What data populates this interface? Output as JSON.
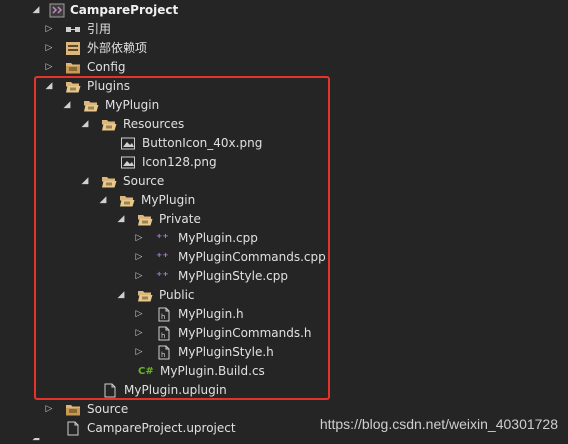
{
  "tree": {
    "solution": "CampareProject",
    "refs": "引用",
    "external_deps": "外部依赖项",
    "config": "Config",
    "plugins": "Plugins",
    "plugin_folder": "MyPlugin",
    "resources": "Resources",
    "res_button_icon": "ButtonIcon_40x.png",
    "res_icon128": "Icon128.png",
    "source_inner": "Source",
    "module_folder": "MyPlugin",
    "private": "Private",
    "cpp_plugin": "MyPlugin.cpp",
    "cpp_commands": "MyPluginCommands.cpp",
    "cpp_style": "MyPluginStyle.cpp",
    "public": "Public",
    "h_plugin": "MyPlugin.h",
    "h_commands": "MyPluginCommands.h",
    "h_style": "MyPluginStyle.h",
    "build_cs": "MyPlugin.Build.cs",
    "uplugin": "MyPlugin.uplugin",
    "source_outer": "Source",
    "uproject": "CampareProject.uproject"
  },
  "glyphs": {
    "expanded": "◢",
    "collapsed": "▷",
    "cpp_mark": "⁺⁺",
    "cs_mark": "C#"
  },
  "watermark": "https://blog.csdn.net/weixin_40301728",
  "colors": {
    "background": "#252526",
    "highlight_border": "#e5322b",
    "folder": "#dcb67a",
    "cpp_purple": "#b180d7",
    "cs_green": "#68b723"
  }
}
